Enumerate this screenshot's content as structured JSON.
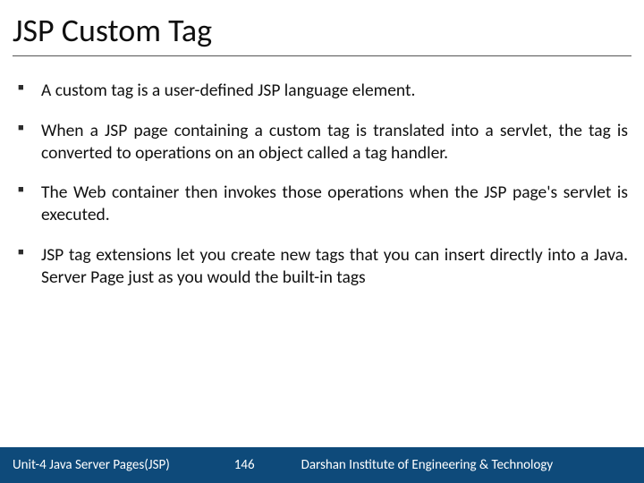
{
  "title": "JSP Custom Tag",
  "bullets": [
    "A custom tag is a user-defined JSP language element.",
    "When a JSP page containing a custom tag is translated into a servlet, the tag is converted to operations on an object called a tag handler.",
    "The Web container then invokes those operations when the JSP page's servlet is executed.",
    "JSP tag extensions let you create new tags that you can insert directly into a Java. Server Page just as you would the built-in tags"
  ],
  "footer": {
    "unit": "Unit-4 Java Server Pages(JSP)",
    "page": "146",
    "institute": "Darshan Institute of Engineering & Technology"
  }
}
